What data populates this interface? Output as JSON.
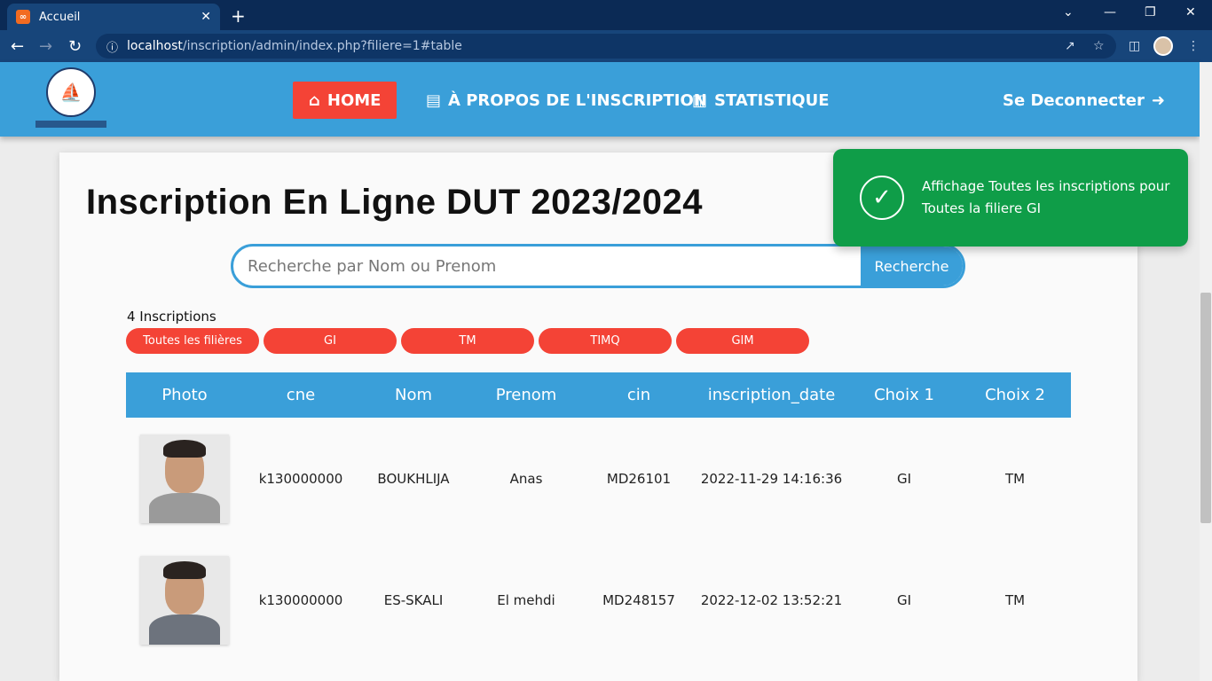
{
  "browser": {
    "tab_title": "Accueil",
    "url_host": "localhost",
    "url_path": "/inscription/admin/index.php?filiere=1#table"
  },
  "nav": {
    "home": "HOME",
    "about": "À PROPOS DE L'INSCRIPTION",
    "stats": "STATISTIQUE",
    "logout": "Se Deconnecter"
  },
  "main": {
    "title": "Inscription En Ligne DUT 2023/2024",
    "search_placeholder": "Recherche par Nom ou Prenom",
    "search_button": "Recherche",
    "count_text": "4 Inscriptions",
    "filters": [
      "Toutes les filières",
      "GI",
      "TM",
      "TIMQ",
      "GIM"
    ]
  },
  "table": {
    "headers": [
      "Photo",
      "cne",
      "Nom",
      "Prenom",
      "cin",
      "inscription_date",
      "Choix 1",
      "Choix 2"
    ],
    "rows": [
      {
        "cne": "k130000000",
        "nom": "BOUKHLIJA",
        "prenom": "Anas",
        "cin": "MD26101",
        "date": "2022-11-29 14:16:36",
        "choix1": "GI",
        "choix2": "TM"
      },
      {
        "cne": "k130000000",
        "nom": "ES-SKALI",
        "prenom": "El mehdi",
        "cin": "MD248157",
        "date": "2022-12-02 13:52:21",
        "choix1": "GI",
        "choix2": "TM"
      }
    ]
  },
  "toast": {
    "message": "Affichage Toutes les inscriptions pour Toutes la filiere GI"
  },
  "colors": {
    "header_blue": "#3a9fd9",
    "accent_red": "#f44336",
    "toast_green": "#0f9d48"
  }
}
